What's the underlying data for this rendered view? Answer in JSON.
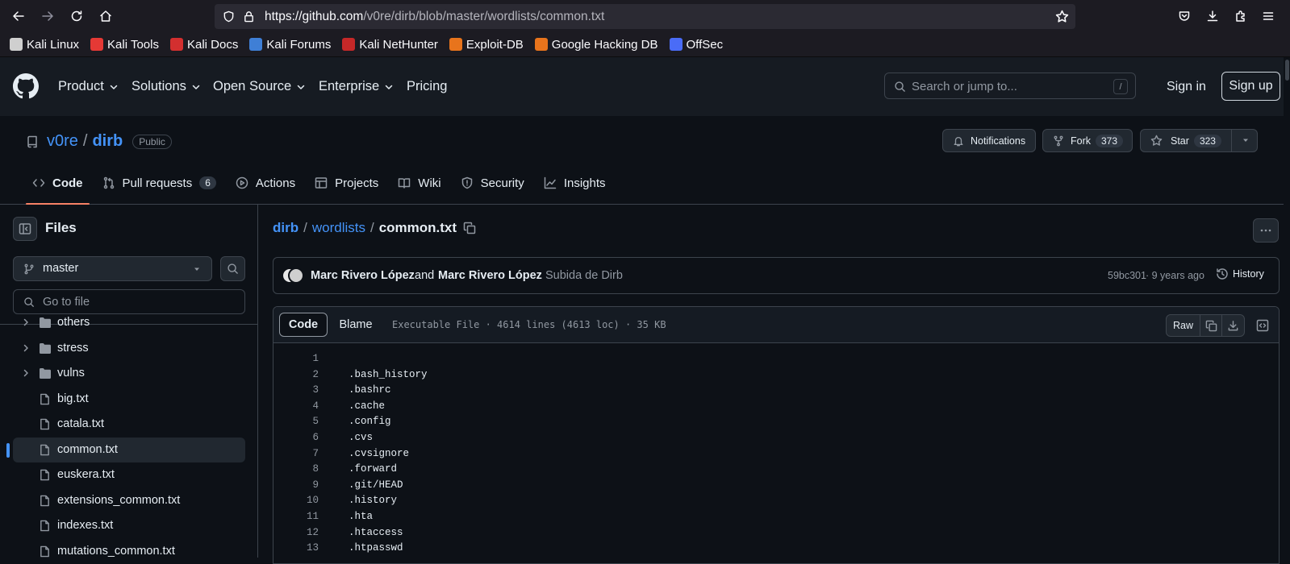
{
  "browser": {
    "url_host": "https://github.com",
    "url_path": "/v0re/dirb/blob/master/wordlists/common.txt",
    "bookmarks": [
      {
        "label": "Kali Linux",
        "icon": "kali-dragon-icon",
        "color": "#cfcfcf"
      },
      {
        "label": "Kali Tools",
        "icon": "kali-tools-icon",
        "color": "#e53935"
      },
      {
        "label": "Kali Docs",
        "icon": "kali-docs-icon",
        "color": "#d32f2f"
      },
      {
        "label": "Kali Forums",
        "icon": "kali-forums-icon",
        "color": "#3f7fd6"
      },
      {
        "label": "Kali NetHunter",
        "icon": "nethunter-icon",
        "color": "#c62828"
      },
      {
        "label": "Exploit-DB",
        "icon": "exploit-db-icon",
        "color": "#e8741c"
      },
      {
        "label": "Google Hacking DB",
        "icon": "ghdb-icon",
        "color": "#e8741c"
      },
      {
        "label": "OffSec",
        "icon": "offsec-icon",
        "color": "#4a6cf7"
      }
    ]
  },
  "header": {
    "nav": [
      "Product",
      "Solutions",
      "Open Source",
      "Enterprise",
      "Pricing"
    ],
    "search_placeholder": "Search or jump to...",
    "search_key": "/",
    "sign_in": "Sign in",
    "sign_up": "Sign up"
  },
  "repo": {
    "owner": "v0re",
    "separator": "/",
    "name": "dirb",
    "visibility": "Public",
    "notifications_label": "Notifications",
    "fork_label": "Fork",
    "fork_count": "373",
    "star_label": "Star",
    "star_count": "323",
    "tabs": [
      {
        "label": "Code",
        "icon": "code-icon"
      },
      {
        "label": "Pull requests",
        "icon": "pull-request-icon",
        "count": "6"
      },
      {
        "label": "Actions",
        "icon": "play-icon"
      },
      {
        "label": "Projects",
        "icon": "table-icon"
      },
      {
        "label": "Wiki",
        "icon": "book-icon"
      },
      {
        "label": "Security",
        "icon": "shield-icon"
      },
      {
        "label": "Insights",
        "icon": "graph-icon"
      }
    ]
  },
  "sidebar": {
    "title": "Files",
    "branch": "master",
    "goto_placeholder": "Go to file",
    "items": [
      {
        "label": "others",
        "type": "folder"
      },
      {
        "label": "stress",
        "type": "folder"
      },
      {
        "label": "vulns",
        "type": "folder"
      },
      {
        "label": "big.txt",
        "type": "file"
      },
      {
        "label": "catala.txt",
        "type": "file"
      },
      {
        "label": "common.txt",
        "type": "file",
        "active": true
      },
      {
        "label": "euskera.txt",
        "type": "file"
      },
      {
        "label": "extensions_common.txt",
        "type": "file"
      },
      {
        "label": "indexes.txt",
        "type": "file"
      },
      {
        "label": "mutations_common.txt",
        "type": "file"
      }
    ]
  },
  "file": {
    "breadcrumb": [
      "dirb",
      "wordlists"
    ],
    "name": "common.txt",
    "commit": {
      "author1": "Marc Rivero López",
      "and_text": "and",
      "author2": "Marc Rivero López",
      "message": "Subida de Dirb",
      "sha": "59bc301",
      "age": "· 9 years ago",
      "history_label": "History"
    },
    "view_code": "Code",
    "view_blame": "Blame",
    "meta": "Executable File · 4614 lines (4613 loc) · 35 KB",
    "raw_label": "Raw",
    "lines": [
      {
        "n": "1",
        "t": ""
      },
      {
        "n": "2",
        "t": ".bash_history"
      },
      {
        "n": "3",
        "t": ".bashrc"
      },
      {
        "n": "4",
        "t": ".cache"
      },
      {
        "n": "5",
        "t": ".config"
      },
      {
        "n": "6",
        "t": ".cvs"
      },
      {
        "n": "7",
        "t": ".cvsignore"
      },
      {
        "n": "8",
        "t": ".forward"
      },
      {
        "n": "9",
        "t": ".git/HEAD"
      },
      {
        "n": "10",
        "t": ".history"
      },
      {
        "n": "11",
        "t": ".hta"
      },
      {
        "n": "12",
        "t": ".htaccess"
      },
      {
        "n": "13",
        "t": ".htpasswd"
      }
    ]
  }
}
